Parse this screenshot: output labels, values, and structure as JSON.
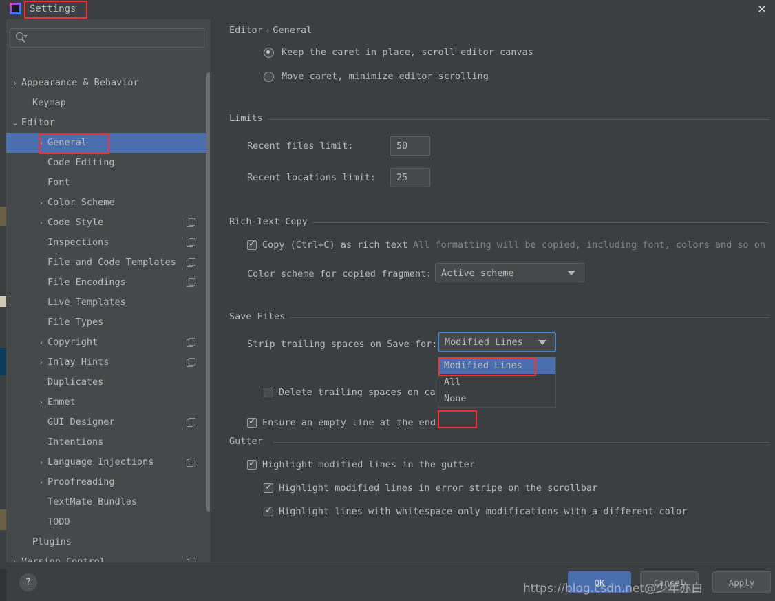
{
  "window": {
    "title": "Settings",
    "close_label": "✕",
    "app_icon": "intellij-idea-icon"
  },
  "sidebar": {
    "search": {
      "value": "",
      "placeholder": ""
    },
    "items": [
      {
        "label": "Appearance & Behavior",
        "indent": 22,
        "arrow": "›",
        "depth": 0,
        "selected": false,
        "copy": false
      },
      {
        "label": "Keymap",
        "indent": 38,
        "arrow": "",
        "depth": 0,
        "selected": false,
        "copy": false
      },
      {
        "label": "Editor",
        "indent": 22,
        "arrow": "⌄",
        "depth": 0,
        "selected": false,
        "copy": false
      },
      {
        "label": "General",
        "indent": 60,
        "arrow": "›",
        "depth": 1,
        "selected": true,
        "copy": false
      },
      {
        "label": "Code Editing",
        "indent": 60,
        "arrow": "",
        "depth": 1,
        "selected": false,
        "copy": false
      },
      {
        "label": "Font",
        "indent": 60,
        "arrow": "",
        "depth": 1,
        "selected": false,
        "copy": false
      },
      {
        "label": "Color Scheme",
        "indent": 60,
        "arrow": "›",
        "depth": 1,
        "selected": false,
        "copy": false
      },
      {
        "label": "Code Style",
        "indent": 60,
        "arrow": "›",
        "depth": 1,
        "selected": false,
        "copy": true
      },
      {
        "label": "Inspections",
        "indent": 60,
        "arrow": "",
        "depth": 1,
        "selected": false,
        "copy": true
      },
      {
        "label": "File and Code Templates",
        "indent": 60,
        "arrow": "",
        "depth": 1,
        "selected": false,
        "copy": true
      },
      {
        "label": "File Encodings",
        "indent": 60,
        "arrow": "",
        "depth": 1,
        "selected": false,
        "copy": true
      },
      {
        "label": "Live Templates",
        "indent": 60,
        "arrow": "",
        "depth": 1,
        "selected": false,
        "copy": false
      },
      {
        "label": "File Types",
        "indent": 60,
        "arrow": "",
        "depth": 1,
        "selected": false,
        "copy": false
      },
      {
        "label": "Copyright",
        "indent": 60,
        "arrow": "›",
        "depth": 1,
        "selected": false,
        "copy": true
      },
      {
        "label": "Inlay Hints",
        "indent": 60,
        "arrow": "›",
        "depth": 1,
        "selected": false,
        "copy": true
      },
      {
        "label": "Duplicates",
        "indent": 60,
        "arrow": "",
        "depth": 1,
        "selected": false,
        "copy": false
      },
      {
        "label": "Emmet",
        "indent": 60,
        "arrow": "›",
        "depth": 1,
        "selected": false,
        "copy": false
      },
      {
        "label": "GUI Designer",
        "indent": 60,
        "arrow": "",
        "depth": 1,
        "selected": false,
        "copy": true
      },
      {
        "label": "Intentions",
        "indent": 60,
        "arrow": "",
        "depth": 1,
        "selected": false,
        "copy": false
      },
      {
        "label": "Language Injections",
        "indent": 60,
        "arrow": "›",
        "depth": 1,
        "selected": false,
        "copy": true
      },
      {
        "label": "Proofreading",
        "indent": 60,
        "arrow": "›",
        "depth": 1,
        "selected": false,
        "copy": false
      },
      {
        "label": "TextMate Bundles",
        "indent": 60,
        "arrow": "",
        "depth": 1,
        "selected": false,
        "copy": false
      },
      {
        "label": "TODO",
        "indent": 60,
        "arrow": "",
        "depth": 1,
        "selected": false,
        "copy": false
      },
      {
        "label": "Plugins",
        "indent": 38,
        "arrow": "",
        "depth": 0,
        "selected": false,
        "copy": false
      },
      {
        "label": "Version Control",
        "indent": 22,
        "arrow": "›",
        "depth": 0,
        "selected": false,
        "copy": true
      }
    ]
  },
  "main": {
    "breadcrumb": {
      "root": "Editor",
      "separator": "›",
      "leaf": "General"
    },
    "caret_options": [
      {
        "label": "Keep the caret in place, scroll editor canvas",
        "checked": true
      },
      {
        "label": "Move caret, minimize editor scrolling",
        "checked": false
      }
    ],
    "limits": {
      "title": "Limits",
      "recent_files_label": "Recent files limit:",
      "recent_files_value": "50",
      "recent_locations_label": "Recent locations limit:",
      "recent_locations_value": "25"
    },
    "rich_text_copy": {
      "title": "Rich-Text Copy",
      "copy_checkbox_label": "Copy (Ctrl+C) as rich text",
      "copy_checkbox_checked": true,
      "copy_hint": "All formatting will be copied, including font, colors and so on",
      "scheme_label": "Color scheme for copied fragment:",
      "scheme_value": "Active scheme",
      "scheme_options": [
        "Active scheme"
      ]
    },
    "save_files": {
      "title": "Save Files",
      "strip_label": "Strip trailing spaces on Save for:",
      "strip_value": "Modified Lines",
      "strip_options": [
        "Modified Lines",
        "All",
        "None"
      ],
      "strip_selected_index": 0,
      "delete_trailing_label": "Delete trailing spaces on ca",
      "delete_trailing_checked": false,
      "ensure_empty_line_label": "Ensure an empty line at the end",
      "ensure_empty_line_checked": true
    },
    "gutter": {
      "title": "Gutter",
      "options": [
        {
          "label": "Highlight modified lines in the gutter",
          "checked": true,
          "indent": 0
        },
        {
          "label": "Highlight modified lines in error stripe on the scrollbar",
          "checked": true,
          "indent": 1
        },
        {
          "label": "Highlight lines with whitespace-only modifications with a different color",
          "checked": true,
          "indent": 1
        }
      ]
    }
  },
  "footer": {
    "help_label": "?",
    "ok_label": "OK",
    "cancel_label": "Cancel",
    "apply_label": "Apply"
  },
  "watermark": {
    "text": "https://blog.csdn.net@少年亦白"
  },
  "colors": {
    "dialog_bg": "#3c3f41",
    "sidebar_bg": "#45494a",
    "selection_blue": "#4b6eaf",
    "highlight_red": "#ff2d2d",
    "focus_border": "#4a88c7",
    "text": "#bbbbbb",
    "muted_text": "#7f8487"
  }
}
